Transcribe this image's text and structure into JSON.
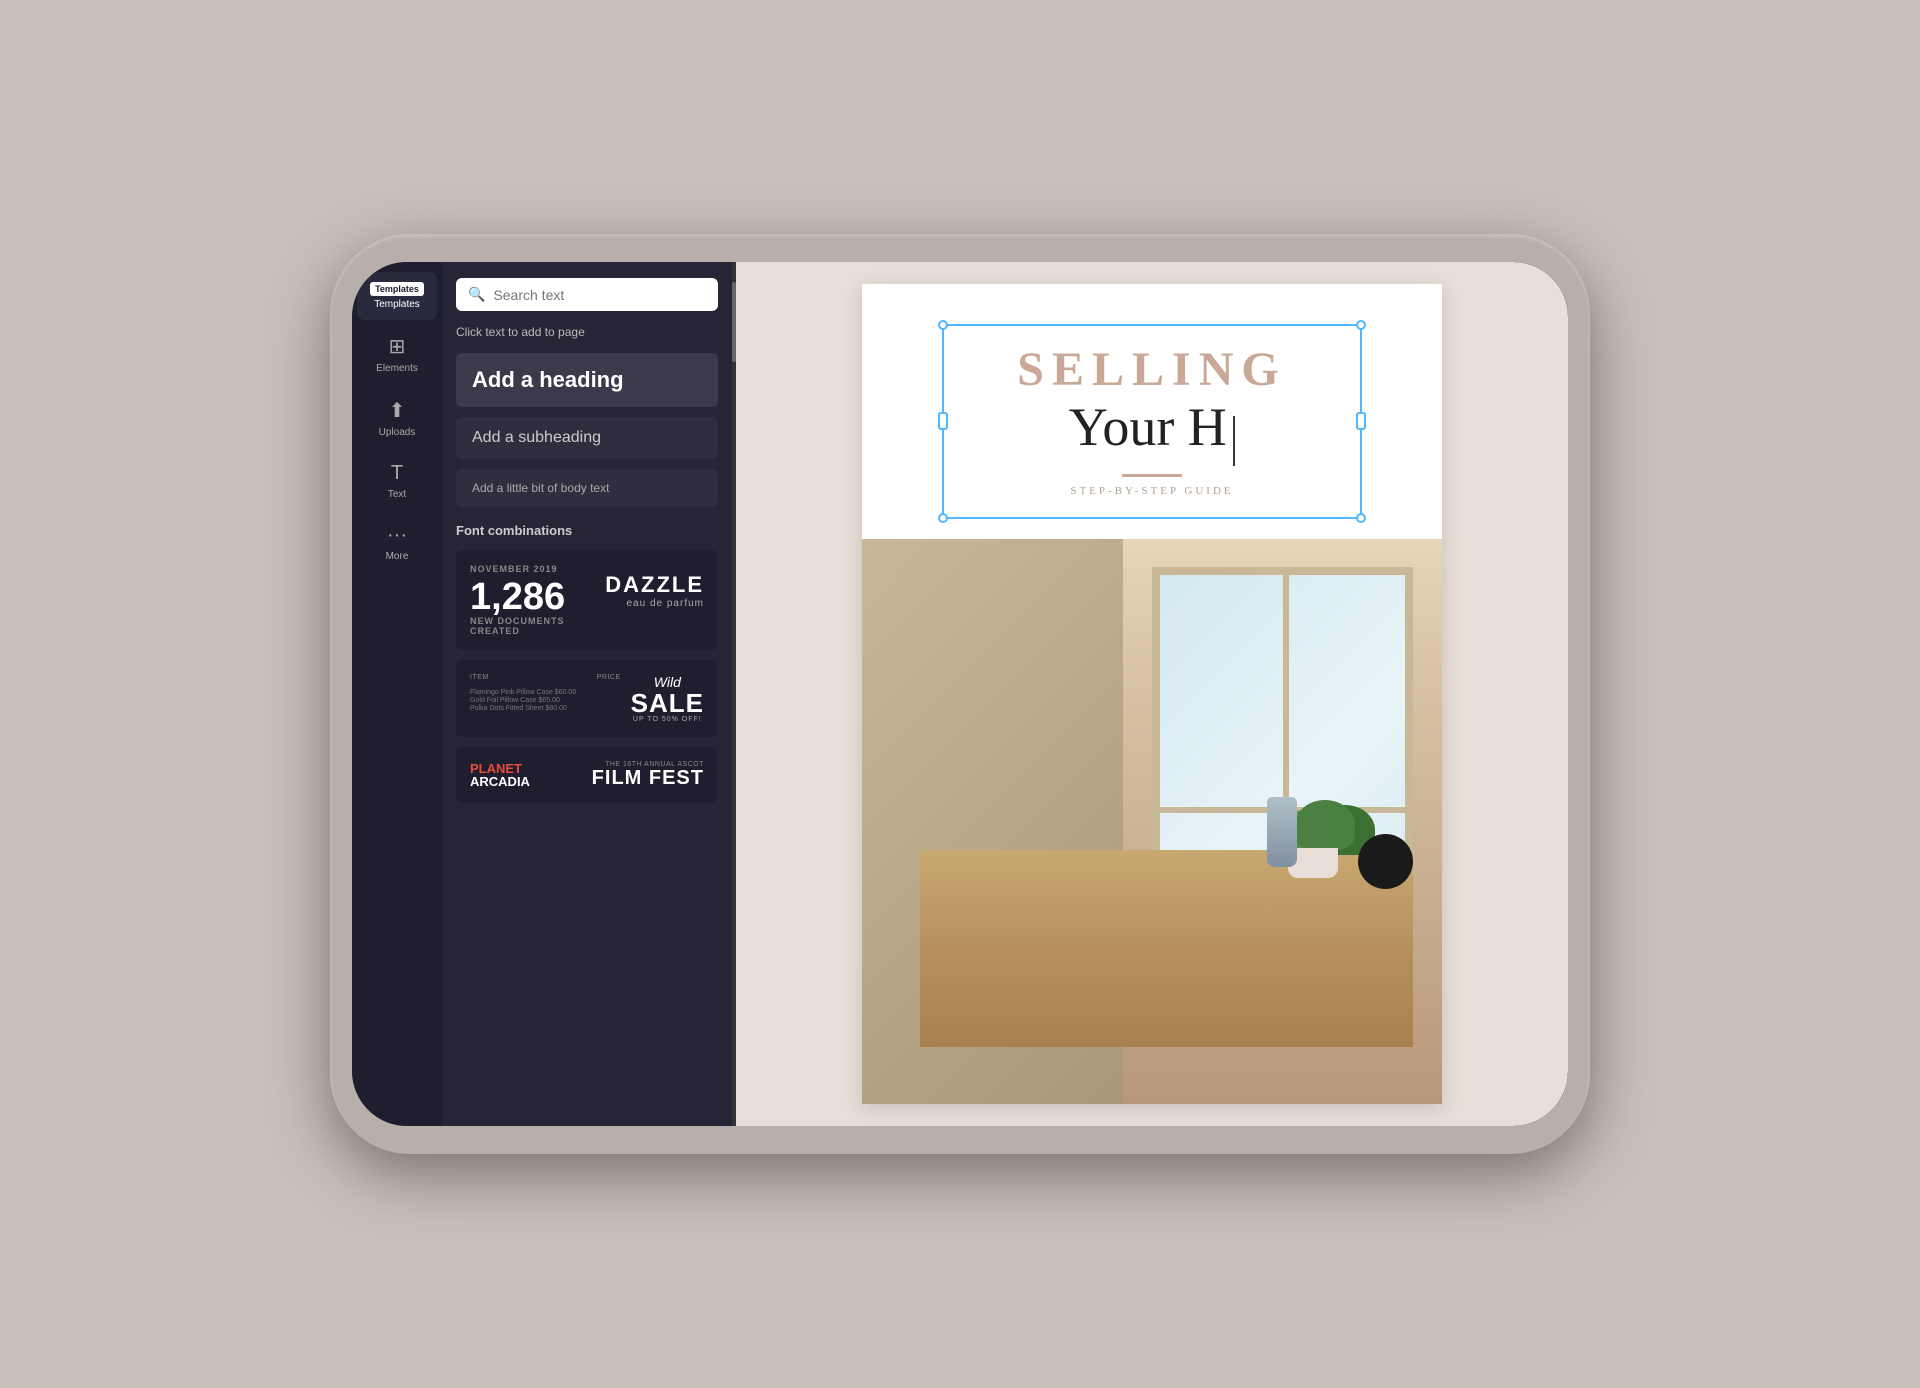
{
  "tablet": {
    "title": "Canva Design Editor"
  },
  "icon_sidebar": {
    "items": [
      {
        "id": "templates",
        "label": "Templates",
        "badge": "Templates",
        "active": true
      },
      {
        "id": "elements",
        "label": "Elements",
        "active": false
      },
      {
        "id": "uploads",
        "label": "Uploads",
        "active": false
      },
      {
        "id": "text",
        "label": "Text",
        "active": false
      },
      {
        "id": "more",
        "label": "More",
        "active": false
      }
    ]
  },
  "text_panel": {
    "search_placeholder": "Search text",
    "click_hint": "Click text to add to page",
    "heading_label": "Add a heading",
    "subheading_label": "Add a subheading",
    "body_label": "Add a little bit of body text",
    "font_combinations_label": "Font combinations",
    "cards": [
      {
        "id": "november",
        "small_label": "NOVEMBER 2019",
        "big_number": "1,286",
        "sub_label": "NEW DOCUMENTS CREATED",
        "right_title": "DAZZLE",
        "right_sub": "eau de parfum"
      },
      {
        "id": "sale",
        "left_label1": "ITEM",
        "left_label2": "PRICE",
        "row1": "Flamingo Pink Pillow Case  $60.00",
        "row2": "Gold Foil Pillow Case  $65.00",
        "row3": "Polka Dots Fitted Sheet  $80.00",
        "wild": "Wild",
        "sale": "SALE",
        "sale_sub": "UP TO 50% OFF!"
      },
      {
        "id": "logos",
        "planet_line1": "PLANET",
        "planet_line2": "ARCADIA",
        "film_pre": "THE 16TH ANNUAL ASCOT",
        "film_title": "FILM FEST"
      }
    ]
  },
  "canvas": {
    "selling_text": "SELLING",
    "your_h_text": "Your H",
    "step_guide": "STEP-BY-STEP GUIDE"
  }
}
